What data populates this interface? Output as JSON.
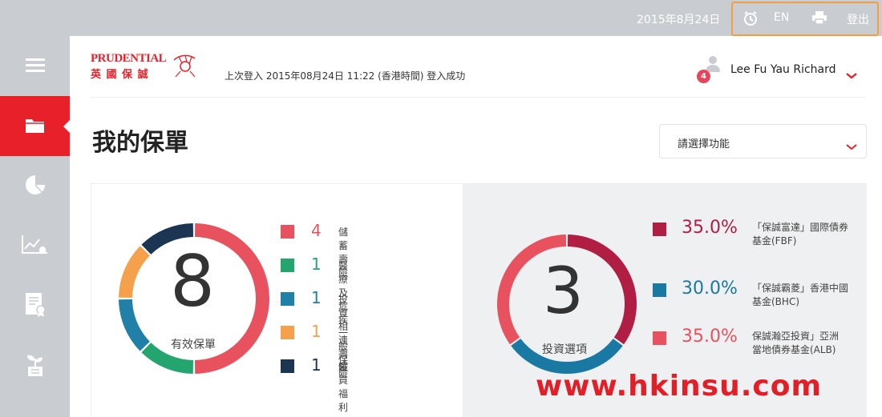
{
  "topbar": {
    "date": "2015年8月24日",
    "lang": "EN",
    "logout": "登出"
  },
  "sidebar": {
    "items": [
      {
        "name": "menu-icon"
      },
      {
        "name": "folder-icon",
        "active": true
      },
      {
        "name": "pie-chart-icon"
      },
      {
        "name": "trend-alert-icon"
      },
      {
        "name": "certificate-icon"
      },
      {
        "name": "plant-icon"
      }
    ]
  },
  "header": {
    "brand_en": "PRUDENTIAL",
    "brand_zh": "英 國 保 誠",
    "last_login": "上次登入 2015年08月24日 11:22 (香港時間) 登入成功",
    "user_name": "Lee Fu Yau Richard",
    "notifications": "4"
  },
  "page": {
    "title": "我的保單",
    "function_select": "請選擇功能"
  },
  "policies": {
    "total": "8",
    "total_label": "有效保單",
    "items": [
      {
        "count": "4",
        "label": "儲蓄壽險",
        "color": "#e8525f"
      },
      {
        "count": "1",
        "label": "醫療及危疾",
        "color": "#24a56f"
      },
      {
        "count": "1",
        "label": "投資相連壽險",
        "color": "#2080a8"
      },
      {
        "count": "1",
        "label": "一般保險",
        "color": "#f5a04a"
      },
      {
        "count": "1",
        "label": "僱員福利",
        "color": "#1c3553"
      }
    ]
  },
  "investments": {
    "total": "3",
    "total_label": "投資選項",
    "items": [
      {
        "pct": "35.0%",
        "label_line1": "「保誠富達」國際債券",
        "label_line2": "基金(FBF)",
        "color": "#b01e43"
      },
      {
        "pct": "30.0%",
        "label_line1": "「保誠霸菱」香港中國",
        "label_line2": "基金(BHC)",
        "color": "#1a79a3"
      },
      {
        "pct": "35.0%",
        "label_line1": "保誠瀚亞投資」亞洲",
        "label_line2": "當地債券基金(ALB)",
        "color": "#e8525f"
      }
    ]
  },
  "watermark": "www.hkinsu.com"
}
